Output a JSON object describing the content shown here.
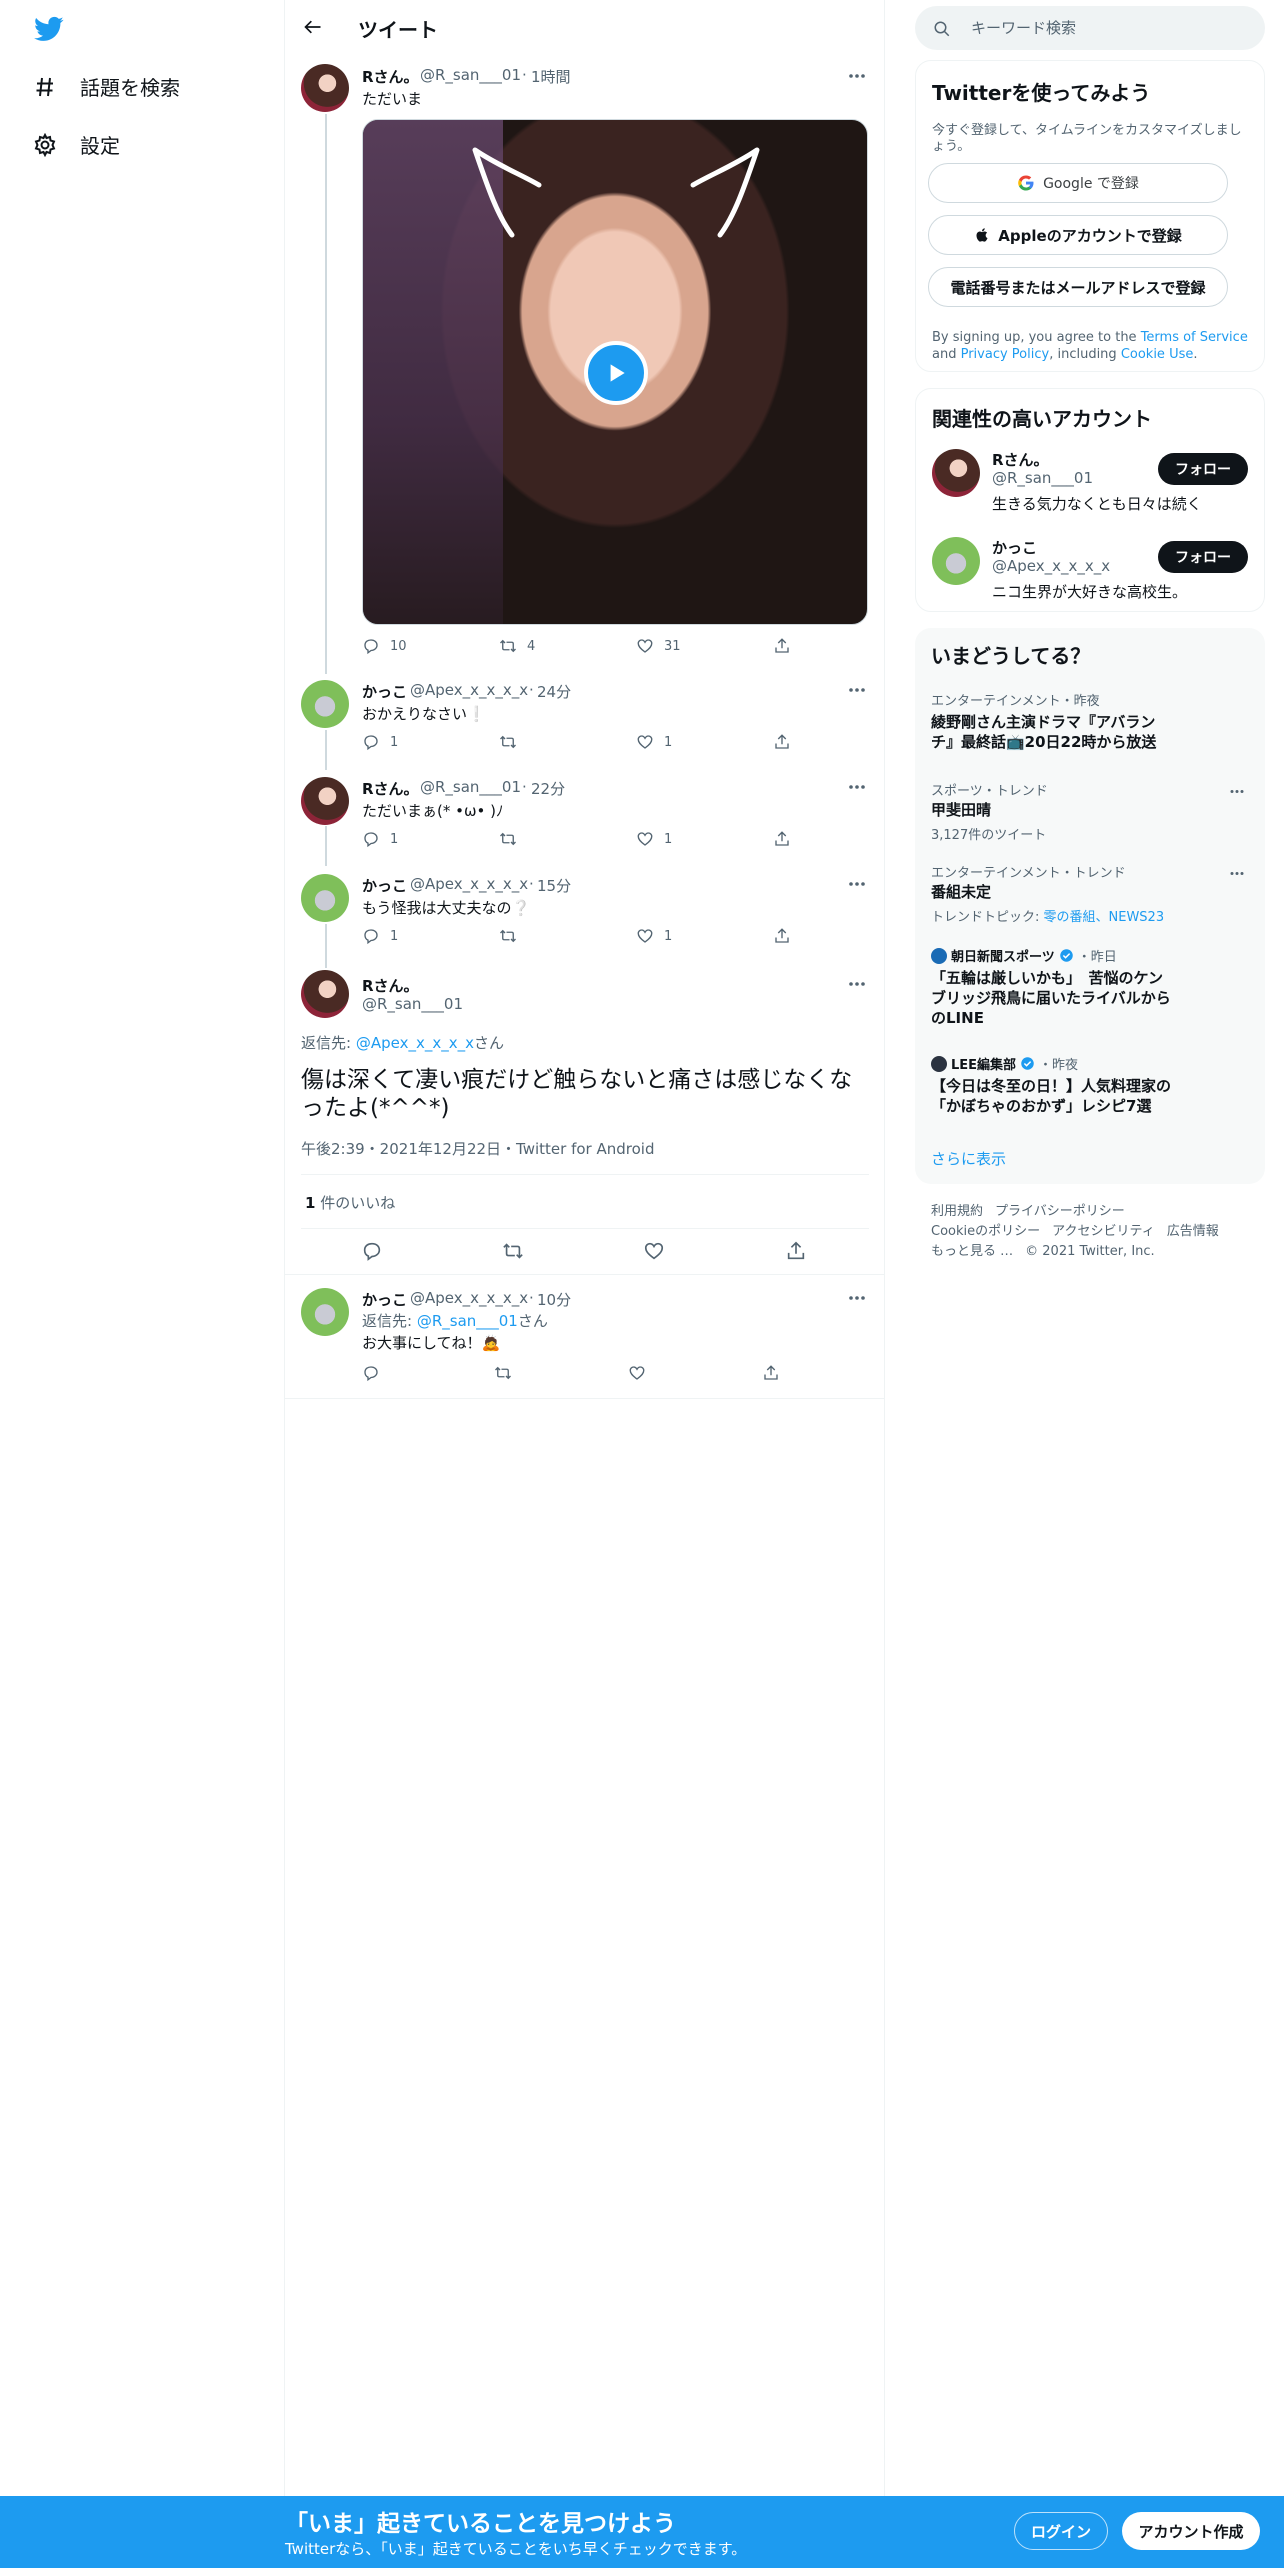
{
  "nav": {
    "explore_label": "話題を検索",
    "settings_label": "設定"
  },
  "header": {
    "title": "ツイート"
  },
  "thread": [
    {
      "name": "Rさん。",
      "handle": "@R_san___01",
      "time": "1時間",
      "text": "ただいま",
      "replies": "10",
      "retweets": "4",
      "likes": "31"
    },
    {
      "name": "かっこ",
      "handle": "@Apex_x_x_x_x",
      "time": "24分",
      "text": "おかえりなさい❕",
      "replies": "1",
      "retweets": "",
      "likes": "1"
    },
    {
      "name": "Rさん。",
      "handle": "@R_san___01",
      "time": "22分",
      "text": "ただいまぁ(* •ω• )ﾉ",
      "replies": "1",
      "retweets": "",
      "likes": "1"
    },
    {
      "name": "かっこ",
      "handle": "@Apex_x_x_x_x",
      "time": "15分",
      "text": "もう怪我は大丈夫なの❔",
      "replies": "1",
      "retweets": "",
      "likes": "1"
    }
  ],
  "main_tweet": {
    "name": "Rさん。",
    "handle": "@R_san___01",
    "reply_prefix": "返信先: ",
    "reply_handle": "@Apex_x_x_x_x",
    "reply_suffix": "さん",
    "text": "傷は深くて凄い痕だけど触らないと痛さは感じなくなったよ(*^^*)",
    "meta": "午後2:39・2021年12月22日・Twitter for Android",
    "like_count": "1",
    "like_label": " 件のいいね"
  },
  "reply": {
    "name": "かっこ",
    "handle": "@Apex_x_x_x_x",
    "time": "10分",
    "reply_prefix": "返信先: ",
    "reply_handle": "@R_san___01",
    "reply_suffix": "さん",
    "text": "お大事にしてね！🙇"
  },
  "search": {
    "placeholder": "キーワード検索"
  },
  "signup_card": {
    "title": "Twitterを使ってみよう",
    "subtitle": "今すぐ登録して、タイムラインをカスタマイズしましょう。",
    "google_label": "Google で登録",
    "apple_label": "Appleのアカウントで登録",
    "phone_label": "電話番号またはメールアドレスで登録",
    "terms_prefix": "By signing up, you agree to the ",
    "terms_link": "Terms of Service",
    "terms_and": " and ",
    "privacy_link": "Privacy Policy",
    "terms_including": ", including ",
    "cookie_link": "Cookie Use",
    "terms_end": "."
  },
  "related_card": {
    "title": "関連性の高いアカウント",
    "accounts": [
      {
        "name": "Rさん。",
        "handle": "@R_san___01",
        "bio": "生きる気力なくとも日々は続く",
        "follow_label": "フォロー"
      },
      {
        "name": "かっこ",
        "handle": "@Apex_x_x_x_x",
        "bio": "ニコ生界が大好きな高校生。",
        "follow_label": "フォロー"
      }
    ]
  },
  "trends_card": {
    "title": "いまどうしてる？",
    "items": [
      {
        "category": "エンターテインメント・昨夜",
        "title": "綾野剛さん主演ドラマ『アバランチ』最終話📺20日22時から放送"
      },
      {
        "category": "スポーツ・トレンド",
        "title": "甲斐田晴",
        "sub": "3,127件のツイート"
      },
      {
        "category": "エンターテインメント・トレンド",
        "title": "番組未定",
        "sub_prefix": "トレンドトピック: ",
        "sub_link": "零の番組、NEWS23"
      }
    ],
    "news": [
      {
        "source": "朝日新聞スポーツ",
        "time": "・昨日",
        "title": "「五輪は厳しいかも」　苦悩のケンブリッジ飛鳥に届いたライバルからのLINE"
      },
      {
        "source": "LEE編集部",
        "time": "・昨夜",
        "title": "【今日は冬至の日！】人気料理家の「かぼちゃのおかず」レシピ7選"
      }
    ],
    "show_more": "さらに表示"
  },
  "footer": {
    "links": [
      "利用規約",
      "プライバシーポリシー",
      "Cookieのポリシー",
      "アクセシビリティ",
      "広告情報",
      "もっと見る …"
    ],
    "copyright": "© 2021 Twitter, Inc."
  },
  "bottom_bar": {
    "title": "「いま」起きていることを見つけよう",
    "subtitle": "Twitterなら、「いま」起きていることをいち早くチェックできます。",
    "login_label": "ログイン",
    "signup_label": "アカウント作成"
  },
  "colors": {
    "accent": "#1d9bf0",
    "text": "#0f1419",
    "muted": "#536471",
    "border": "#eff3f4"
  }
}
